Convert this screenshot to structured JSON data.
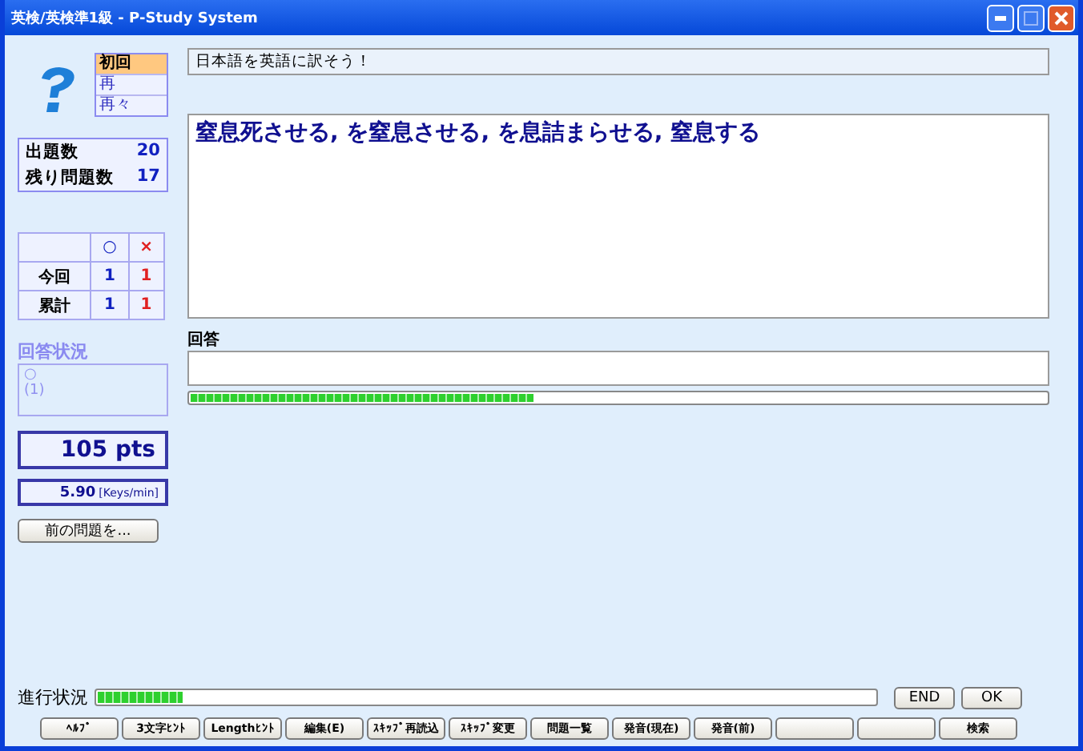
{
  "window": {
    "title": "英検/英検準1級 - P-Study System"
  },
  "modes": [
    {
      "label": "初回",
      "selected": true
    },
    {
      "label": "再",
      "selected": false
    },
    {
      "label": "再々",
      "selected": false
    }
  ],
  "instruction": "日本語を英語に訳そう！",
  "counts": [
    {
      "label": "出題数",
      "value": "20"
    },
    {
      "label": "残り問題数",
      "value": "17"
    }
  ],
  "score_table": {
    "columns": [
      "○",
      "×"
    ],
    "rows": [
      {
        "label": "今回",
        "correct": "1",
        "wrong": "1"
      },
      {
        "label": "累計",
        "correct": "1",
        "wrong": "1"
      }
    ]
  },
  "answer_status": {
    "title": "回答状況",
    "mark": "○",
    "note": "(1)"
  },
  "points": "105 pts",
  "speed": {
    "value": "5.90",
    "unit": "[Keys/min]"
  },
  "previous_button": "前の問題を...",
  "question": "窒息死させる, を窒息させる, を息詰まらせる, 窒息する",
  "answer": {
    "label": "回答",
    "level": 0.4
  },
  "progress": {
    "label": "進行状況",
    "level": 0.11
  },
  "actions": [
    "END",
    "OK"
  ],
  "function_keys": [
    {
      "kind": "text",
      "label": "ﾍﾙﾌﾟ"
    },
    {
      "kind": "text",
      "label": "3文字ﾋﾝﾄ"
    },
    {
      "kind": "text",
      "label": "Lengthﾋﾝﾄ"
    },
    {
      "kind": "text",
      "label": "編集(E)"
    },
    {
      "kind": "text",
      "label": "ｽｷｯﾌﾟ再読込"
    },
    {
      "kind": "text",
      "label": "ｽｷｯﾌﾟ変更"
    },
    {
      "kind": "text",
      "label": "問題一覧"
    },
    {
      "kind": "text",
      "label": "発音(現在)"
    },
    {
      "kind": "text",
      "label": "発音(前)"
    },
    {
      "kind": "blank"
    },
    {
      "kind": "blank"
    },
    {
      "kind": "text",
      "label": "検索"
    }
  ]
}
